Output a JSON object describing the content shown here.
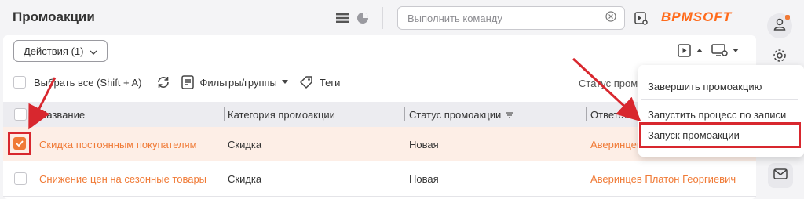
{
  "header": {
    "title": "Промоакции",
    "command_placeholder": "Выполнить команду",
    "logo": "BPMSOFT"
  },
  "toolbar": {
    "actions_label": "Действия (1)",
    "select_all_label": "Выбрать все (Shift + A)",
    "filters_label": "Фильтры/группы",
    "tags_label": "Теги",
    "status_filter_label": "Статус промоа"
  },
  "table": {
    "columns": [
      "Название",
      "Категория промоакции",
      "Статус промоакции",
      "Ответств"
    ],
    "rows": [
      {
        "name": "Скидка постоянным покупателям",
        "category": "Скидка",
        "status": "Новая",
        "owner": "Аверинцев"
      },
      {
        "name": "Снижение цен на сезонные товары",
        "category": "Скидка",
        "status": "Новая",
        "owner": "Аверинцев Платон Георгиевич"
      }
    ]
  },
  "menu": {
    "items": [
      "Завершить промоакцию",
      "Запустить процесс по записи",
      "Запуск промоакции"
    ]
  },
  "colors": {
    "accent": "#f07a36",
    "highlight": "#d8272e",
    "selected_row": "#fdeee6"
  }
}
